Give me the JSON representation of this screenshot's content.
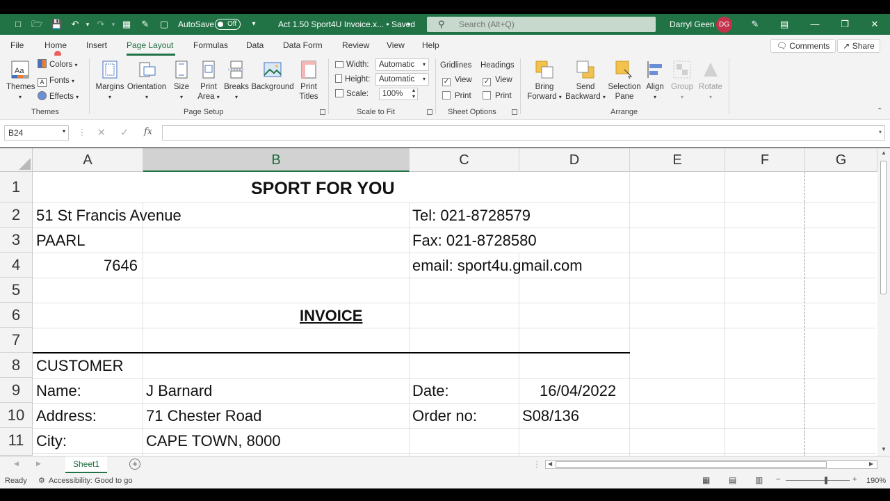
{
  "title_bar": {
    "autosave_label": "AutoSave",
    "autosave_state": "Off",
    "doc_title": "Act 1.50 Sport4U Invoice.x... • Saved",
    "search_placeholder": "Search (Alt+Q)",
    "user_name": "Darryl Geen",
    "user_initials": "DG"
  },
  "tabs": [
    "File",
    "Home",
    "Insert",
    "Page Layout",
    "Formulas",
    "Data",
    "Data Form",
    "Review",
    "View",
    "Help"
  ],
  "active_tab": "Page Layout",
  "comments_label": "Comments",
  "share_label": "Share",
  "ribbon": {
    "themes": {
      "themes": "Themes",
      "colors": "Colors",
      "fonts": "Fonts",
      "effects": "Effects",
      "group": "Themes"
    },
    "page_setup": {
      "margins": "Margins",
      "orientation": "Orientation",
      "size": "Size",
      "print_area": "Print Area",
      "breaks": "Breaks",
      "background": "Background",
      "print_titles": "Print Titles",
      "group": "Page Setup"
    },
    "scale_to_fit": {
      "width_label": "Width:",
      "width_value": "Automatic",
      "height_label": "Height:",
      "height_value": "Automatic",
      "scale_label": "Scale:",
      "scale_value": "100%",
      "group": "Scale to Fit"
    },
    "sheet_options": {
      "gridlines": "Gridlines",
      "headings": "Headings",
      "view": "View",
      "print": "Print",
      "group": "Sheet Options"
    },
    "arrange": {
      "bring_forward": "Bring Forward",
      "send_backward": "Send Backward",
      "selection_pane": "Selection Pane",
      "align": "Align",
      "group_btn": "Group",
      "rotate": "Rotate",
      "group": "Arrange"
    }
  },
  "name_box": "B24",
  "columns": [
    "A",
    "B",
    "C",
    "D",
    "E",
    "F",
    "G"
  ],
  "selected_column": "B",
  "rows": [
    "1",
    "2",
    "3",
    "4",
    "5",
    "6",
    "7",
    "8",
    "9",
    "10",
    "11"
  ],
  "cells": {
    "r1_title": "SPORT FOR YOU",
    "r2_a": "51 St Francis Avenue",
    "r2_c": "Tel: 021-8728579",
    "r3_a": "PAARL",
    "r3_c": "Fax: 021-8728580",
    "r4_a": "7646",
    "r4_c": "email: sport4u.gmail.com",
    "r6_invoice": "INVOICE",
    "r8_a": "CUSTOMER",
    "r9_a": "Name:",
    "r9_b": "J Barnard",
    "r9_c": "Date:",
    "r9_d": "16/04/2022",
    "r10_a": "Address:",
    "r10_b": "71 Chester Road",
    "r10_c": "Order no:",
    "r10_d": "S08/136",
    "r11_a": "City:",
    "r11_b": "CAPE TOWN, 8000"
  },
  "sheet_tab": "Sheet1",
  "status": {
    "ready": "Ready",
    "accessibility": "Accessibility: Good to go",
    "zoom": "190%"
  }
}
